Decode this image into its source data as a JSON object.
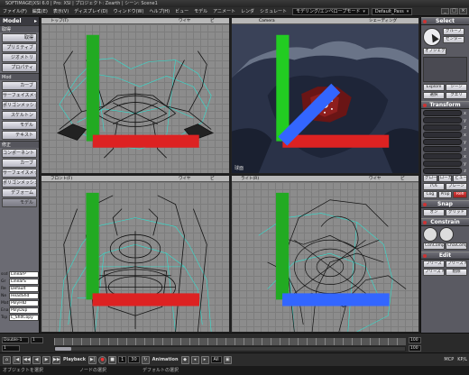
{
  "titlebar": {
    "text": "SOFTIMAGE|XSI 6.0 | Pro: XSI | プロジェクト: Zearth | シーン: Scene1"
  },
  "menubar": {
    "items": [
      "ファイル(F)",
      "編集(E)",
      "表示(V)",
      "ディスプレイ(D)",
      "ウィンドウ(W)",
      "ヘルプ(H)",
      "ビュー",
      "モデル",
      "アニメート",
      "レンダ",
      "シミュレート"
    ],
    "mode_value": "モデリング/エンベロープモード",
    "pass_value": "Default_Pass",
    "window_buttons": [
      "_",
      "□",
      "×"
    ]
  },
  "left_panel": {
    "header": "Model",
    "header_arrow": "▸",
    "buttons_top": [
      "取得",
      "プリミティブ",
      "ジオメトリ",
      "プロパティ"
    ],
    "section_mod": "Mod",
    "buttons_mid": [
      "カーブ",
      "サーフェイスメッシュ",
      "ポリゴンメッシュ",
      "スケルトン",
      "モデル",
      "テキスト"
    ],
    "section_create": "修正",
    "buttons_bottom": [
      "コンポーネント",
      "カーブ",
      "サーフェイスメッシュ",
      "ポリゴンメッシュ",
      "デフォーム",
      "モデル"
    ],
    "tiny_labels": [
      "ssd",
      "Gr",
      "Re",
      "Ne",
      "Mat",
      "Ena",
      "Tsp"
    ],
    "tiny_values": [
      "LinearP",
      "LinearS",
      "Default",
      "HeadShd",
      "PolyHID",
      "PolyDup",
      "L_ShdCopy"
    ]
  },
  "viewports": {
    "top_left": {
      "tab": "トップ(T)",
      "label": "",
      "tabs": [
        "トップ(T)",
        "ワイヤ",
        "ピ"
      ]
    },
    "top_right": {
      "tab": "Camera",
      "label": "球面",
      "tabs": [
        "Camera",
        "シェーディング"
      ]
    },
    "bottom_left": {
      "tab": "フロント(F)",
      "label": "",
      "tabs": [
        "フロント(F)",
        "ワイヤ",
        "ピ"
      ]
    },
    "bottom_right": {
      "tab": "ライト(R)",
      "label": "",
      "tabs": [
        "ライト(R)",
        "ワイヤ",
        "ピ"
      ]
    }
  },
  "right_panel": {
    "select_header": "Select",
    "select_buttons": [
      "グループ",
      "センター",
      "オブジェクト"
    ],
    "explore_buttons": [
      "Explore",
      "シーン"
    ],
    "name_buttons": [
      "選択",
      "クエリ"
    ],
    "transform_header": "Transform",
    "xyz": [
      "x",
      "y",
      "z"
    ],
    "transform_buttons": [
      "グローバル",
      "ローカル",
      "ビュー"
    ],
    "ref_buttons": [
      "パル",
      "プレーン"
    ],
    "prop_buttons": [
      "Cog",
      "Prop",
      "Refl"
    ],
    "snap_header": "Snap",
    "snap_buttons": [
      "オン",
      "グリッド"
    ],
    "constrain_header": "Constrain",
    "constrain_buttons": [
      "ConCompe",
      "ChaiComp"
    ],
    "edit_header": "Edit",
    "edit_buttons": [
      "フリーズ",
      "フリーズ M",
      "フリーズ M",
      "削除",
      "フリーズ"
    ]
  },
  "timeline": {
    "start_field": "Double-1",
    "start_value": "1",
    "end_value": "100",
    "end_value2": "100",
    "frame_value": "1"
  },
  "playbar": {
    "playback_label": "Playback",
    "frame_value": "1",
    "fps_value": "30",
    "animation_label": "Animation",
    "all_label": "All",
    "mcp": "MCP",
    "kp": "KP/L",
    "controls": [
      "|◀",
      "◀◀",
      "◀",
      "▶",
      "▶▶",
      "▶|",
      "●",
      "■"
    ]
  },
  "statusbar": {
    "left": "オブジェクトを選択",
    "mid": "ノードの選択",
    "right": "デフォルトの選択"
  },
  "colors": {
    "grid": "#8c8c8c",
    "wire_cyan": "#30e0d0",
    "wire_black": "#111111",
    "panel_bg": "#5a5a62"
  }
}
